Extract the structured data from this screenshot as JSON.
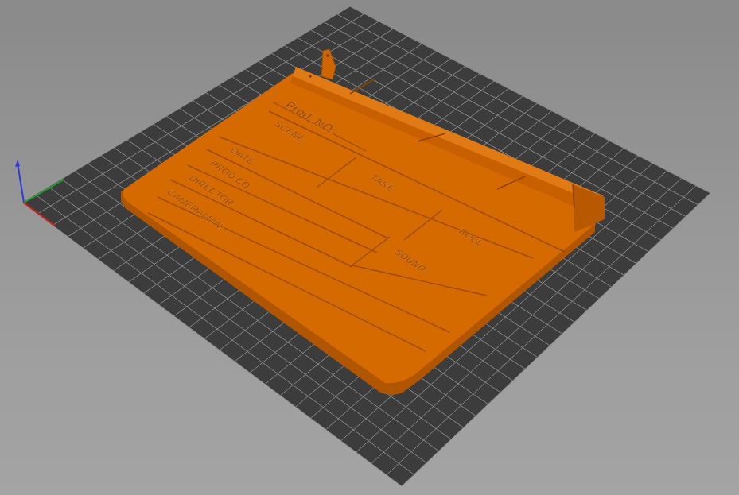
{
  "viewport": {
    "board_labels": [
      {
        "text": "Prod .NO:"
      },
      {
        "text": "SCENE:"
      },
      {
        "text": "DATE:"
      },
      {
        "text": "TAKE:"
      },
      {
        "text": "PROD.CO:"
      },
      {
        "text": "DIRECTOR:"
      },
      {
        "text": "ROLL:"
      },
      {
        "text": "CAMERAMAN:"
      },
      {
        "text": "SOUND:"
      }
    ]
  }
}
